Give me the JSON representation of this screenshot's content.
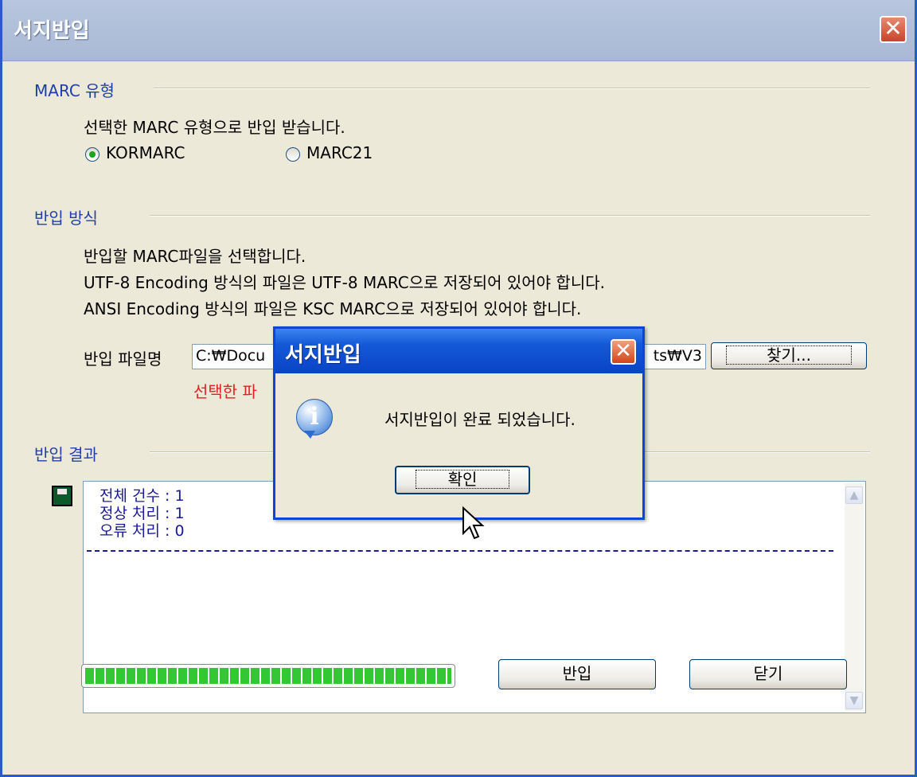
{
  "window": {
    "title": "서지반입",
    "close_symbol": "✕"
  },
  "marc_type": {
    "label": "MARC 유형",
    "description": "선택한 MARC 유형으로 반입 받습니다.",
    "options": [
      {
        "label": "KORMARC",
        "selected": true
      },
      {
        "label": "MARC21",
        "selected": false
      }
    ]
  },
  "import_method": {
    "label": "반입 방식",
    "lines": [
      "반입할 MARC파일을 선택합니다.",
      "UTF-8 Encoding 방식의 파일은 UTF-8 MARC으로 저장되어 있어야 합니다.",
      "ANSI Encoding 방식의 파일은 KSC MARC으로 저장되어 있어야 합니다."
    ],
    "file_label": "반입 파일명",
    "file_value_left": "C:₩Docu",
    "file_value_right": "ts₩V3",
    "browse_button": "찾기...",
    "warning_text": "선택한 파"
  },
  "import_result": {
    "label": "반입 결과",
    "lines": [
      "전체 건수 : 1",
      "정상 처리 : 1",
      "오류 처리 : 0"
    ],
    "progress_percent": 100
  },
  "buttons": {
    "import": "반입",
    "close": "닫기"
  },
  "dialog": {
    "title": "서지반입",
    "icon_letter": "i",
    "message": "서지반입이 완료 되었습니다.",
    "ok_button": "확인",
    "close_symbol": "✕"
  },
  "colors": {
    "section_label": "#1f3fa8",
    "warning": "#e02020",
    "progress": "#33c833",
    "result_text": "#1a1a9c"
  }
}
